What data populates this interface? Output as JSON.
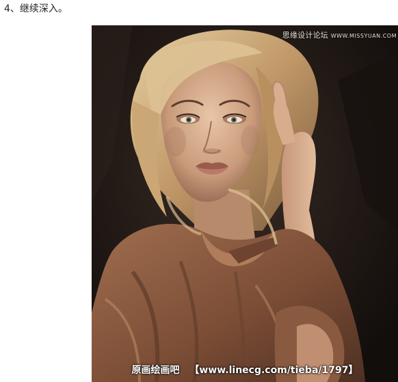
{
  "step": {
    "heading": "4、继续深入。"
  },
  "painting": {
    "watermark_top": "思缘设计论坛",
    "watermark_top_sub": "WWW.MISSYUAN.COM",
    "watermark_bottom_cn": "原画绘画吧",
    "watermark_bottom_url": "【www.linecg.com/tieba/1797】",
    "palette": {
      "background": "#1c1614",
      "hair": "#c9a878",
      "skin": "#d9b393",
      "blouse": "#8a5a40",
      "lips": "#a8675a"
    }
  }
}
